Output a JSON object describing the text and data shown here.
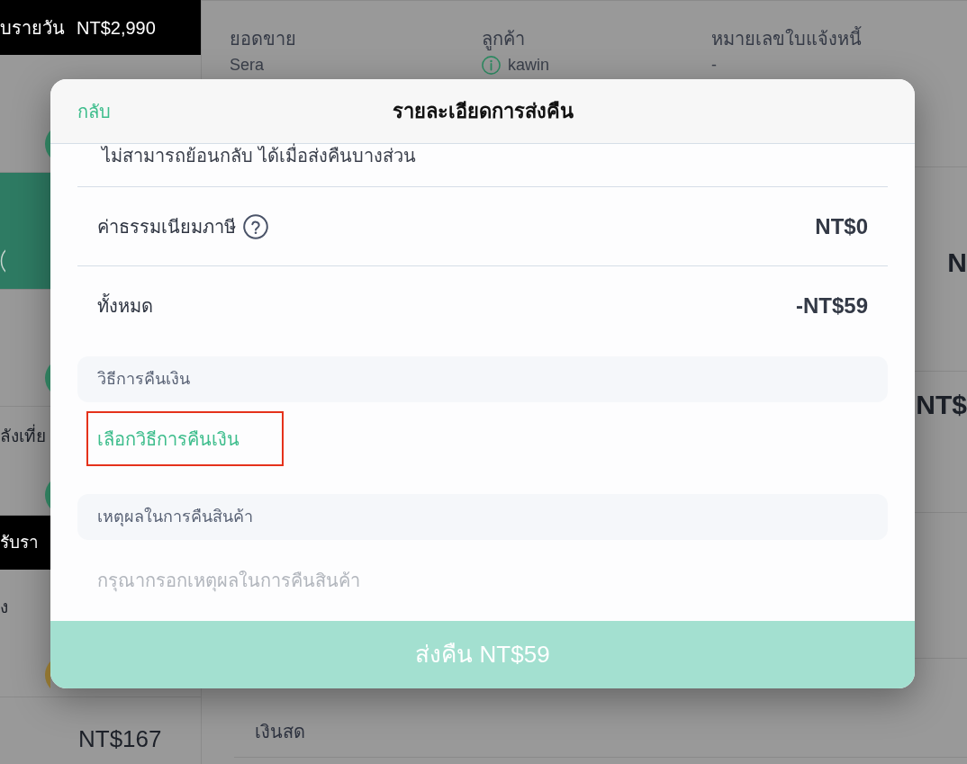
{
  "sidebar": {
    "rows": [
      {
        "kind": "group_header",
        "label": "บรายวัน",
        "amount": "NT$2,990"
      },
      {
        "kind": "order",
        "selected": false,
        "color": "#2e7b5c"
      },
      {
        "kind": "order",
        "selected": true
      },
      {
        "kind": "order",
        "selected": false,
        "color": "#2e7b5c"
      },
      {
        "kind": "order",
        "selected": false,
        "title": "ลังเที่ย",
        "color": "#2e7b5c"
      },
      {
        "kind": "group_header",
        "label": "รับรา"
      },
      {
        "kind": "order",
        "selected": false,
        "title": "ง",
        "color": "#8f7430"
      },
      {
        "kind": "order",
        "selected": false,
        "amount": "NT$167"
      }
    ]
  },
  "order_header": {
    "fields": [
      {
        "kind": "plain",
        "label": "ยอดขาย",
        "value": "Sera"
      },
      {
        "kind": "info",
        "label": "ลูกค้า",
        "value": "kawin"
      },
      {
        "kind": "plain",
        "label": "หมายเลขใบแจ้งหนี้",
        "value": "-"
      }
    ]
  },
  "line_items": [
    {
      "amount": "N"
    },
    {
      "amount": "NT$"
    }
  ],
  "payment": {
    "value": "เงินสด"
  },
  "return_dialog": {
    "back": "กลับ",
    "title": "รายละเอียดการส่งคืน",
    "note": "ไม่สามารถย้อนกลับ ได้เมื่อส่งคืนบางส่วน",
    "summary": [
      {
        "label": "ค่าธรรมเนียมภาษี",
        "help": true,
        "value": "NT$0"
      },
      {
        "label": "ทั้งหมด",
        "help": false,
        "value": "-NT$59"
      }
    ],
    "refund_method": {
      "heading": "วิธีการคืนเงิน",
      "action": "เลือกวิธีการคืนเงิน",
      "highlighted": true
    },
    "reason": {
      "heading": "เหตุผลในการคืนสินค้า",
      "placeholder": "กรุณากรอกเหตุผลในการคืนสินค้า"
    },
    "submit": {
      "label": "ส่งคืน NT$59",
      "disabled": true
    }
  }
}
